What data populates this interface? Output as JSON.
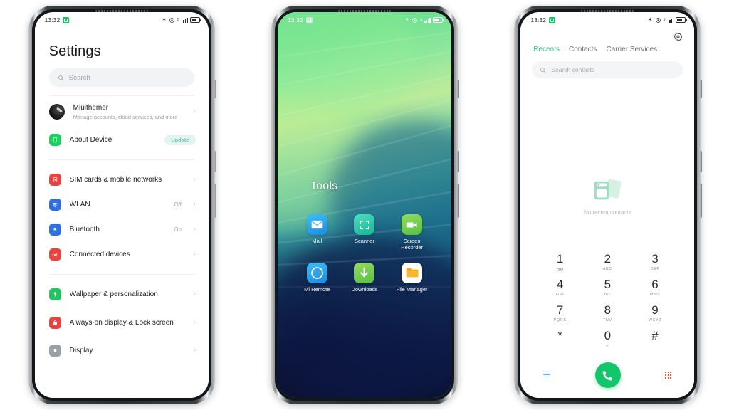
{
  "statusbar": {
    "time": "13:32",
    "icons": [
      "green-chip-icon",
      "bluetooth-icon",
      "alarm-icon",
      "signal-icon",
      "battery-icon"
    ]
  },
  "phone1_settings": {
    "title": "Settings",
    "search": {
      "placeholder": "Search",
      "icon": "search-icon"
    },
    "account": {
      "name": "Miuithemer",
      "subtitle": "Manage accounts, cloud services, and more",
      "avatar": "user-avatar"
    },
    "about": {
      "label": "About Device",
      "badge": "Update",
      "badge_bg": "#e3f3ef",
      "badge_fg": "#3fb69a",
      "icon": "phone-icon",
      "icon_color": "#18d45f"
    },
    "group_network": [
      {
        "label": "SIM cards & mobile networks",
        "value": "",
        "icon": "sim-icon",
        "icon_color": "#e8433f"
      },
      {
        "label": "WLAN",
        "value": "Off",
        "icon": "wifi-icon",
        "icon_color": "#2f6fe0"
      },
      {
        "label": "Bluetooth",
        "value": "On",
        "icon": "bluetooth-icon",
        "icon_color": "#2f6fe0"
      },
      {
        "label": "Connected devices",
        "value": "",
        "icon": "connected-devices-icon",
        "icon_color": "#e8433f"
      }
    ],
    "group_display": [
      {
        "label": "Wallpaper & personalization",
        "value": "",
        "icon": "wallpaper-icon",
        "icon_color": "#1ec660"
      },
      {
        "label": "Always-on display & Lock screen",
        "value": "",
        "icon": "lock-icon",
        "icon_color": "#e8433f"
      },
      {
        "label": "Display",
        "value": "",
        "icon": "display-icon",
        "icon_color": "#9aa0a6"
      }
    ]
  },
  "phone2_home": {
    "folder_title": "Tools",
    "apps": [
      {
        "name": "Mail",
        "icon": "mail-icon",
        "color_a": "#35b4f5",
        "color_b": "#1a8de0"
      },
      {
        "name": "Scanner",
        "icon": "scanner-icon",
        "color_a": "#3fd6b0",
        "color_b": "#18b79a"
      },
      {
        "name": "Screen Recorder",
        "icon": "screen-recorder-icon",
        "color_a": "#8fd957",
        "color_b": "#5cc14a"
      },
      {
        "name": "Mi Remote",
        "icon": "mi-remote-icon",
        "color_a": "#35b4f5",
        "color_b": "#1a8de0"
      },
      {
        "name": "Downloads",
        "icon": "downloads-icon",
        "color_a": "#8fd957",
        "color_b": "#5cc14a"
      },
      {
        "name": "File Manager",
        "icon": "file-manager-icon",
        "color_a": "#ffffff",
        "color_b": "#f2f2f2"
      }
    ]
  },
  "phone3_dialer": {
    "gear": "settings-gear-icon",
    "tabs": [
      {
        "label": "Recents",
        "active": true
      },
      {
        "label": "Contacts",
        "active": false
      },
      {
        "label": "Carrier Services",
        "active": false
      }
    ],
    "accent": "#2ec277",
    "search": {
      "placeholder": "Search contacts",
      "icon": "search-icon"
    },
    "empty": {
      "text": "No recent contacts",
      "icon": "no-contacts-illustration"
    },
    "keys": [
      {
        "num": "1",
        "sub": "",
        "voicemail": true
      },
      {
        "num": "2",
        "sub": "ABC"
      },
      {
        "num": "3",
        "sub": "DEF"
      },
      {
        "num": "4",
        "sub": "GHI"
      },
      {
        "num": "5",
        "sub": "JKL"
      },
      {
        "num": "6",
        "sub": "MNO"
      },
      {
        "num": "7",
        "sub": "PQRS"
      },
      {
        "num": "8",
        "sub": "TUV"
      },
      {
        "num": "9",
        "sub": "WXYZ"
      },
      {
        "num": "*",
        "sub": ","
      },
      {
        "num": "0",
        "sub": "+"
      },
      {
        "num": "#",
        "sub": ""
      }
    ],
    "footer": {
      "menu_icon": "menu-icon",
      "call_icon": "call-icon",
      "call_bg": "#13c56b",
      "keypad_icon": "keypad-grid-icon"
    }
  }
}
